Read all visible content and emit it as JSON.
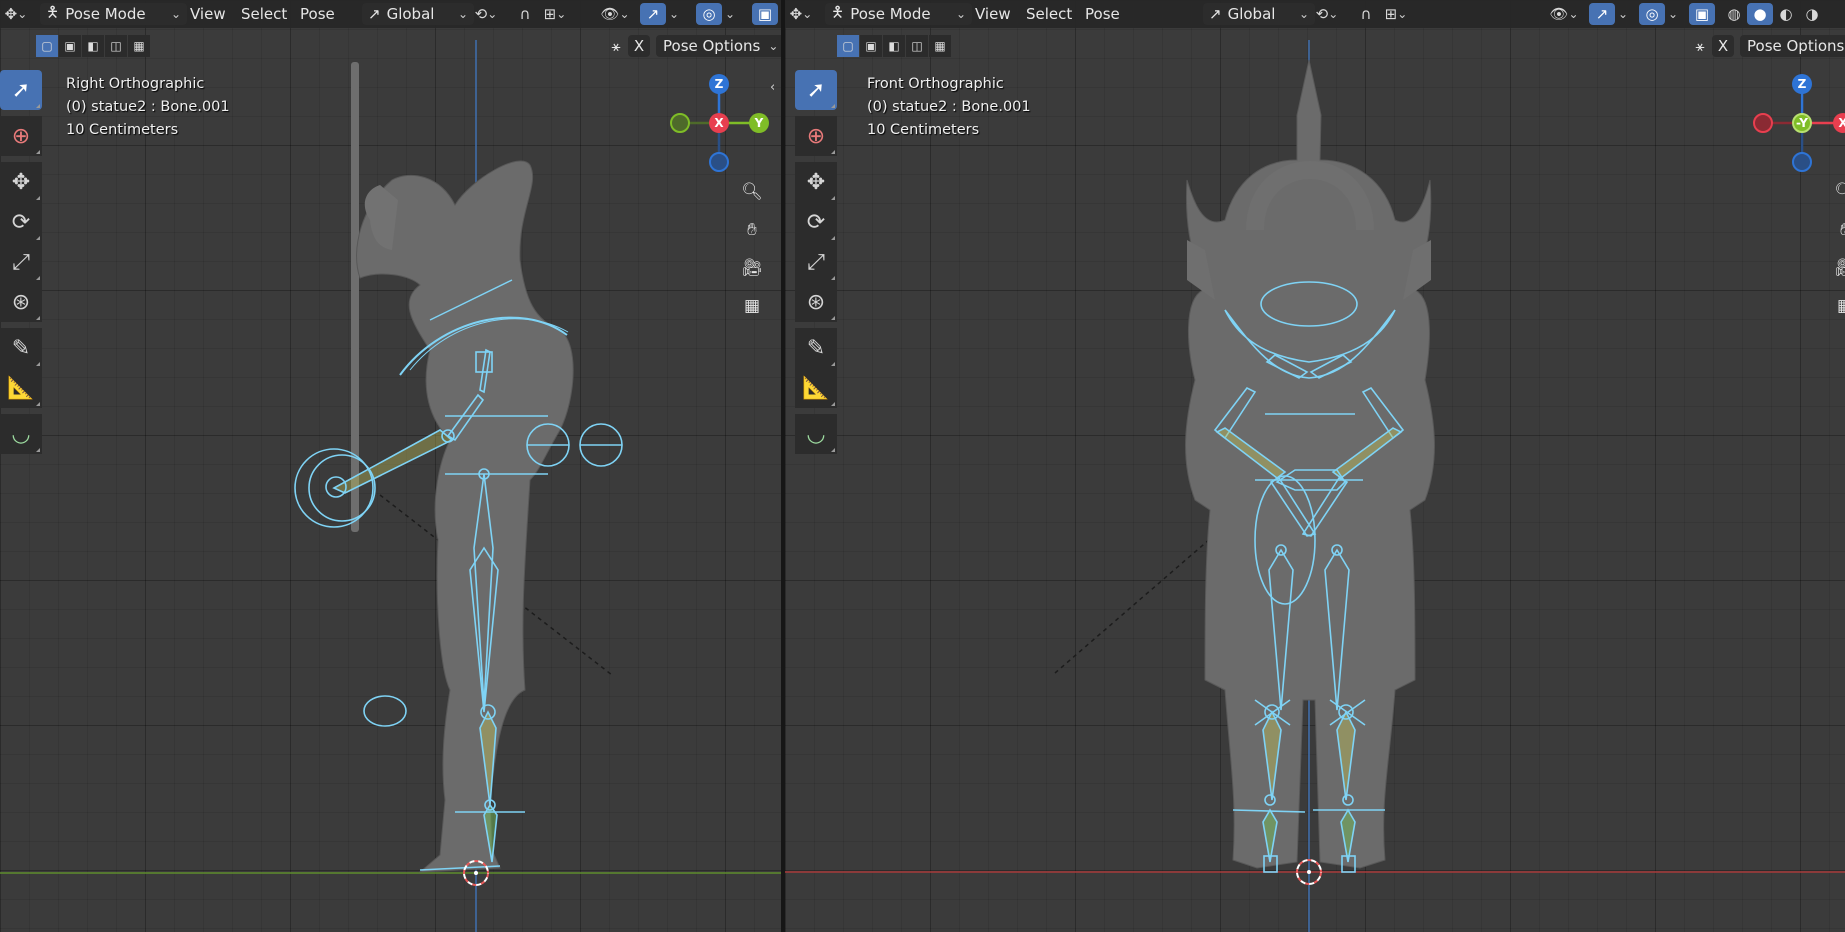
{
  "left": {
    "mode_label": "Pose Mode",
    "menus": {
      "view": "View",
      "select": "Select",
      "pose": "Pose"
    },
    "orientation_label": "Global",
    "pose_options_label": "Pose Options",
    "overlay": {
      "view_name": "Right Orthographic",
      "object_info": "(0) statue2 : Bone.001",
      "scale": "10 Centimeters"
    },
    "gizmo": {
      "up": "Z",
      "center": "X",
      "side": "Y"
    },
    "x_label": "X"
  },
  "right": {
    "mode_label": "Pose Mode",
    "menus": {
      "view": "View",
      "select": "Select",
      "pose": "Pose"
    },
    "orientation_label": "Global",
    "pose_options_label": "Pose Options",
    "overlay": {
      "view_name": "Front Orthographic",
      "object_info": "(0) statue2 : Bone.001",
      "scale": "10 Centimeters"
    },
    "gizmo": {
      "up": "Z",
      "center": "-Y",
      "side": "X"
    },
    "x_label": "X"
  },
  "tools": [
    "select-box-tool",
    "cursor-tool",
    "move-tool",
    "rotate-tool",
    "scale-tool",
    "transform-tool",
    "annotate-tool",
    "measure-tool",
    "relax-pose-tool"
  ],
  "colors": {
    "accent": "#4772b3",
    "bone": "#7fd3f5",
    "axis_x": "#e83f4f",
    "axis_y": "#7fbd27",
    "axis_z": "#2e74d6",
    "header_bg": "#282828",
    "viewport_bg": "#3b3b3b"
  }
}
